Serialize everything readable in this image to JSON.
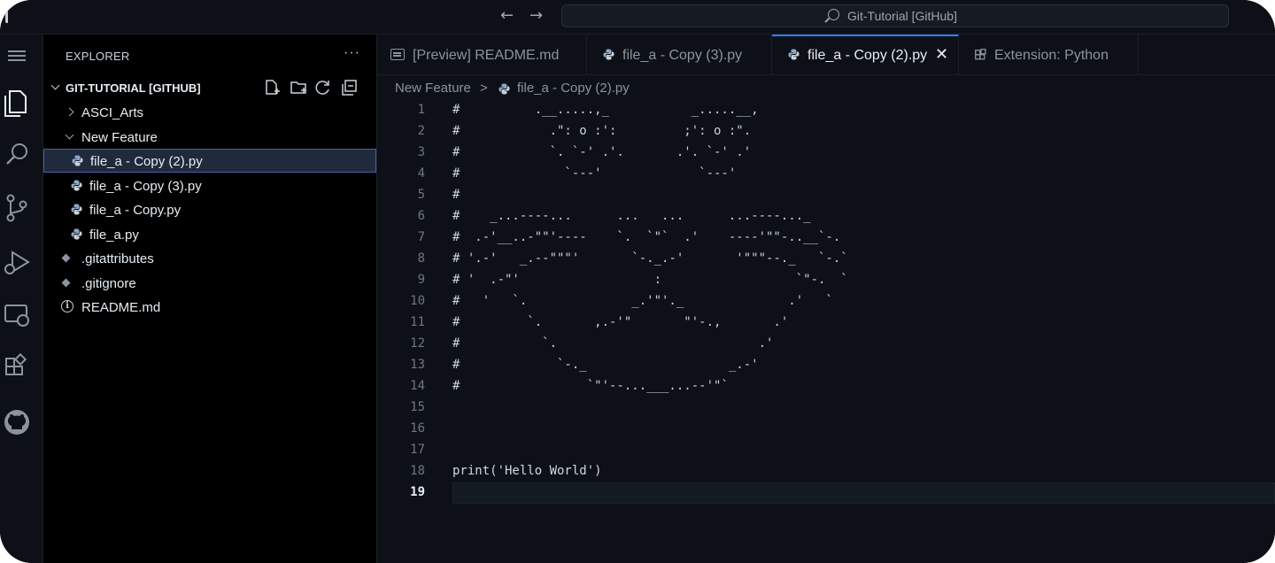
{
  "titlebar": {
    "search_text": "Git-Tutorial [GitHub]"
  },
  "activitybar": {
    "icons": [
      "menu-icon",
      "explorer-icon",
      "search-icon",
      "source-control-icon",
      "run-debug-icon",
      "remote-explorer-icon",
      "extensions-icon",
      "github-icon"
    ]
  },
  "sidebar": {
    "title": "EXPLORER",
    "more": "···",
    "repo": "GIT-TUTORIAL [GITHUB]",
    "items": [
      {
        "label": "ASCI_Arts",
        "kind": "folder-collapsed"
      },
      {
        "label": "New Feature",
        "kind": "folder-expanded"
      },
      {
        "label": "file_a - Copy (2).py",
        "kind": "python-file",
        "selected": true
      },
      {
        "label": "file_a - Copy (3).py",
        "kind": "python-file"
      },
      {
        "label": "file_a - Copy.py",
        "kind": "python-file"
      },
      {
        "label": "file_a.py",
        "kind": "python-file"
      },
      {
        "label": ".gitattributes",
        "kind": "git-file"
      },
      {
        "label": ".gitignore",
        "kind": "git-file"
      },
      {
        "label": "README.md",
        "kind": "info-file"
      }
    ]
  },
  "tabs": [
    {
      "label": "[Preview] README.md",
      "icon": "preview-icon",
      "active": false
    },
    {
      "label": "file_a - Copy (3).py",
      "icon": "python-icon",
      "active": false
    },
    {
      "label": "file_a - Copy (2).py",
      "icon": "python-icon",
      "active": true,
      "close": "✕"
    },
    {
      "label": "Extension: Python",
      "icon": "extensions-icon",
      "active": false
    }
  ],
  "breadcrumb": {
    "folder": "New Feature",
    "separator": ">",
    "file": "file_a - Copy (2).py"
  },
  "code": {
    "current_line": 19,
    "lines": [
      "#          .__.....,_           _.....__,",
      "#            .\": o :':         ;': o :\".",
      "#            `. `-' .'.       .'. `-' .'",
      "#              `---'             `---'",
      "#",
      "#    _...----...      ...   ...      ...----..._",
      "#  .-'__..-\"\"'----    `.  `\"`  .'    ----'\"\"-..__`-.",
      "# '.-'   _.--\"\"\"'       `-._.-'       '\"\"\"--._   `-.`",
      "# '  .-\"'                  :                  `\"-.  `",
      "#   '   `.              _.'\"'._              .'   `",
      "#         `.       ,.-'\"       \"'-.,       .'",
      "#           `.                           .'",
      "#             `-._                   _.-'",
      "#                 `\"'--...___...--'\"`",
      "",
      "",
      "",
      "print('Hello World')",
      ""
    ]
  }
}
